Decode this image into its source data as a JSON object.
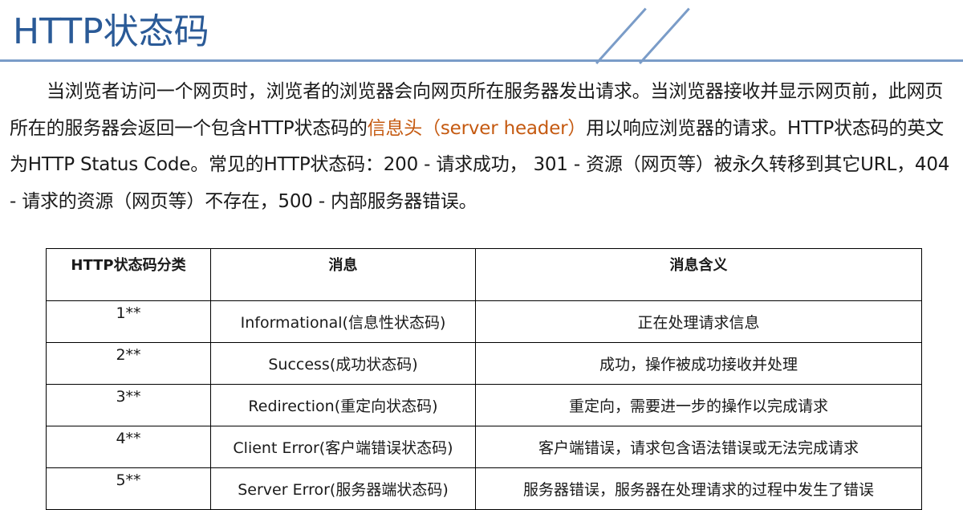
{
  "title": "HTTP状态码",
  "accent_color": "#2a5a97",
  "highlight_color": "#c55a11",
  "paragraph": {
    "part1": "当浏览者访问一个网页时，浏览者的浏览器会向网页所在服务器发出请求。当浏览器接收并显示网页前，此网页所在的服务器会返回一个包含HTTP状态码的",
    "highlight": "信息头（server header）",
    "part2": "用以响应浏览器的请求。HTTP状态码的英文为HTTP Status Code。常见的HTTP状态码：200 - 请求成功， 301 - 资源（网页等）被永久转移到其它URL，404 - 请求的资源（网页等）不存在，500 - 内部服务器错误。"
  },
  "table": {
    "headers": [
      "HTTP状态码分类",
      "消息",
      "消息含义"
    ],
    "rows": [
      {
        "code": "1**",
        "message": "Informational(信息性状态码)",
        "meaning": "正在处理请求信息"
      },
      {
        "code": "2**",
        "message": "Success(成功状态码)",
        "meaning": "成功，操作被成功接收并处理"
      },
      {
        "code": "3**",
        "message": "Redirection(重定向状态码)",
        "meaning": "重定向，需要进一步的操作以完成请求"
      },
      {
        "code": "4**",
        "message": "Client Error(客户端错误状态码)",
        "meaning": "客户端错误，请求包含语法错误或无法完成请求"
      },
      {
        "code": "5**",
        "message": "Server Error(服务器端状态码)",
        "meaning": "服务器错误，服务器在处理请求的过程中发生了错误"
      }
    ]
  }
}
